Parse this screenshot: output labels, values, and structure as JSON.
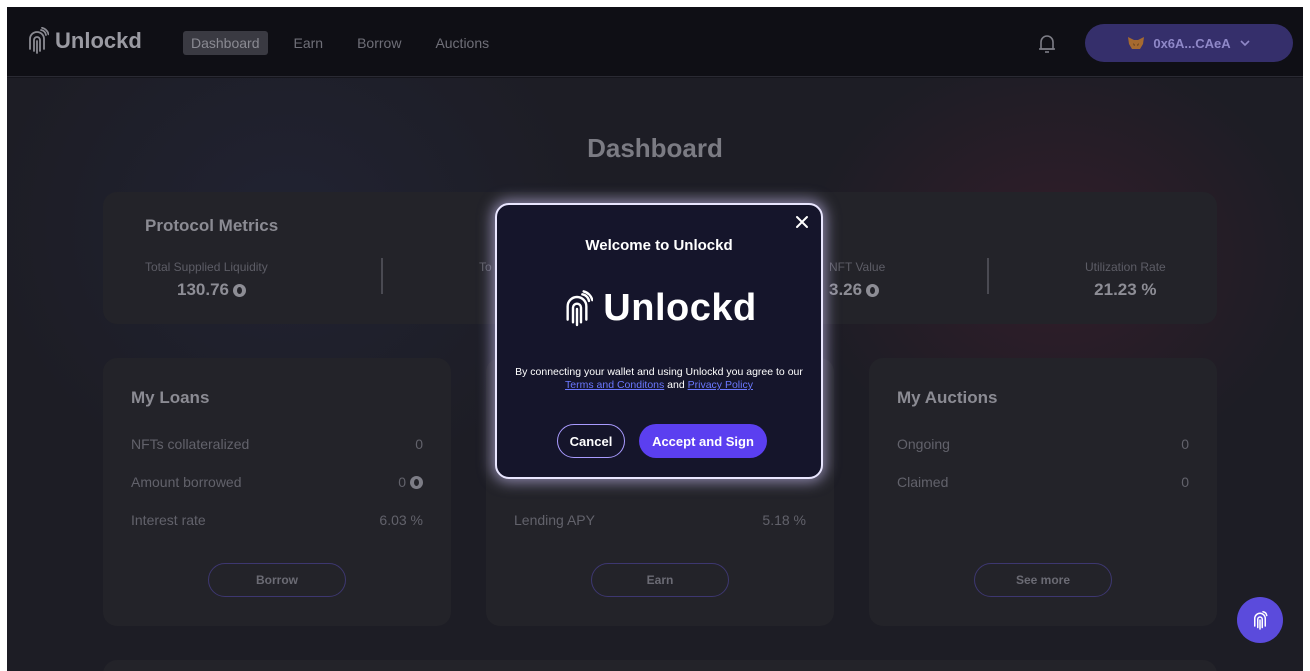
{
  "header": {
    "logo_text": "Unlockd",
    "nav": [
      "Dashboard",
      "Earn",
      "Borrow",
      "Auctions"
    ],
    "active_nav": "Dashboard",
    "wallet_label": "0x6A...CAeA"
  },
  "main": {
    "title": "Dashboard",
    "metrics": {
      "title": "Protocol Metrics",
      "items": [
        {
          "label": "Total Supplied Liquidity",
          "value": "130.76"
        },
        {
          "label": "To"
        },
        {
          "label": "NFT Value",
          "value": "3.26"
        },
        {
          "label": "Utilization Rate",
          "value": "21.23 %"
        }
      ]
    },
    "loans": {
      "title": "My Loans",
      "rows": [
        {
          "label": "NFTs collateralized",
          "value": "0"
        },
        {
          "label": "Amount borrowed",
          "value": "0"
        },
        {
          "label": "Interest rate",
          "value": "6.03 %"
        }
      ],
      "button": "Borrow"
    },
    "earn": {
      "rows": [
        {
          "label": "Lending APY",
          "value": "5.18 %"
        }
      ],
      "button": "Earn"
    },
    "auctions": {
      "title": "My Auctions",
      "rows": [
        {
          "label": "Ongoing",
          "value": "0"
        },
        {
          "label": "Claimed",
          "value": "0"
        }
      ],
      "button": "See more"
    }
  },
  "modal": {
    "title": "Welcome to Unlockd",
    "logo_text": "Unlockd",
    "terms_prefix": "By connecting your wallet and using Unlockd you agree to our ",
    "terms_link": "Terms and Conditons",
    "terms_and": " and ",
    "privacy_link": "Privacy Policy",
    "cancel_label": "Cancel",
    "accept_label": "Accept and Sign"
  },
  "icons": {
    "logo": "unlockd-fingerprint-icon",
    "bell": "bell-icon",
    "wallet": "metamask-fox-icon",
    "chevron": "chevron-down-icon",
    "close": "close-icon",
    "eth": "eth-coin-icon"
  },
  "colors": {
    "accent": "#5b3ff0",
    "modal_bg": "#15152b",
    "link": "#6b78ff"
  }
}
